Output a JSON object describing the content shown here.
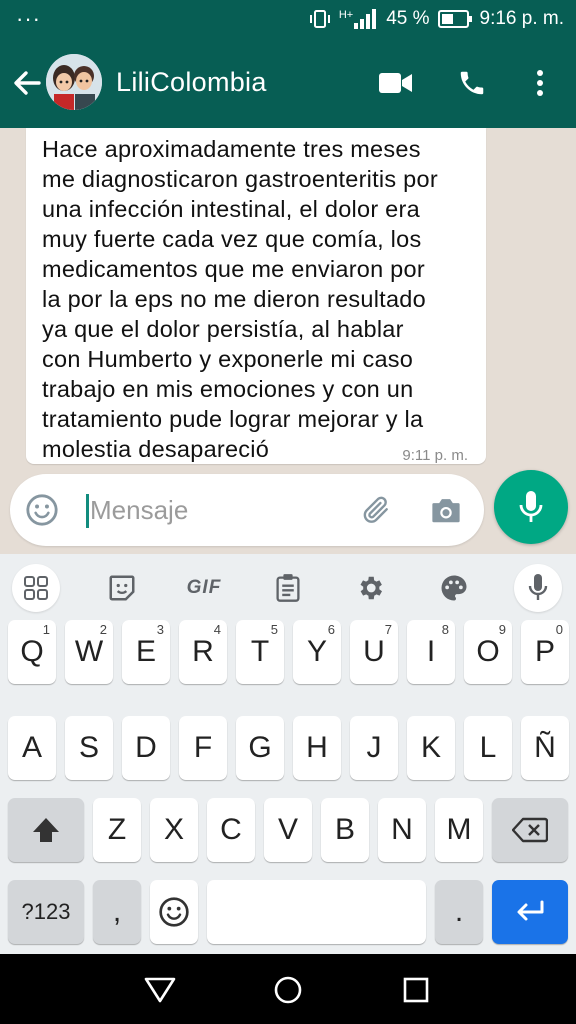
{
  "status_bar": {
    "menu_dots": "···",
    "network": "H+",
    "battery_percent": "45 %",
    "time": "9:16 p. m."
  },
  "header": {
    "contact_name": "LiliColombia",
    "icons": [
      "back-arrow-icon",
      "avatar",
      "video-call-icon",
      "phone-icon",
      "more-vert-icon"
    ]
  },
  "message": {
    "lines": [
      "Hace aproximadamente tres meses",
      "me diagnosticaron gastroenteritis por",
      "una infección intestinal, el dolor era",
      "muy fuerte cada vez que comía, los",
      "medicamentos que me enviaron por",
      "la por la eps no me dieron resultado",
      "ya que el dolor persistía, al hablar",
      "con Humberto y exponerle mi caso",
      "trabajo en mis emociones y con un",
      "tratamiento pude lograr mejorar y la",
      "molestia desapareció"
    ],
    "time": "9:11 p. m."
  },
  "composer": {
    "placeholder": "Mensaje",
    "value": ""
  },
  "keyboard": {
    "toolbar": {
      "gif_label": "GIF"
    },
    "row1": [
      {
        "label": "Q",
        "hint": "1"
      },
      {
        "label": "W",
        "hint": "2"
      },
      {
        "label": "E",
        "hint": "3"
      },
      {
        "label": "R",
        "hint": "4"
      },
      {
        "label": "T",
        "hint": "5"
      },
      {
        "label": "Y",
        "hint": "6"
      },
      {
        "label": "U",
        "hint": "7"
      },
      {
        "label": "I",
        "hint": "8"
      },
      {
        "label": "O",
        "hint": "9"
      },
      {
        "label": "P",
        "hint": "0"
      }
    ],
    "row2": [
      "A",
      "S",
      "D",
      "F",
      "G",
      "H",
      "J",
      "K",
      "L",
      "Ñ"
    ],
    "row3": [
      "Z",
      "X",
      "C",
      "V",
      "B",
      "N",
      "M"
    ],
    "symbols_label": "?123",
    "comma_label": ",",
    "period_label": "."
  },
  "colors": {
    "header": "#075e54",
    "accent": "#00a884",
    "enter_key": "#1a73e8"
  }
}
